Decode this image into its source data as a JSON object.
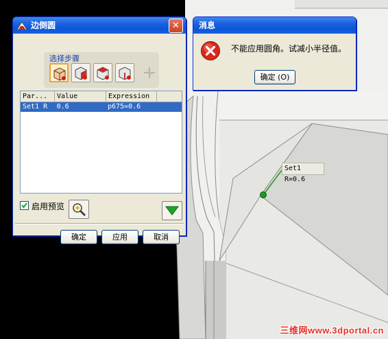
{
  "fillet_dialog": {
    "title": "边倒圆",
    "close_glyph": "✕",
    "steps": {
      "label": "选择步骤",
      "buttons": [
        "edge-select-icon",
        "variable-radius-icon",
        "setback-icon",
        "stop-short-icon",
        "cliff-edge-icon"
      ]
    },
    "table": {
      "headers": [
        "Par...",
        "Value",
        "Expression"
      ],
      "rows": [
        {
          "param": "Set1 R",
          "value": "0.6",
          "expression": "p675=0.6"
        }
      ]
    },
    "preview": {
      "label": "启用预览",
      "checked": true
    },
    "buttons": {
      "ok": "确定",
      "apply": "应用",
      "cancel": "取消"
    }
  },
  "message_dialog": {
    "title": "消息",
    "text": "不能应用圆角。试减小半径值。",
    "ok_label": "确定 (O)"
  },
  "viewport": {
    "dimension_label": "Set1 R=0.6",
    "watermark": "三维网www.3dportal.cn",
    "colors": {
      "background": "#000000",
      "surface": "#e6e6e2",
      "shadow": "#c9c9c5",
      "handle": "#1f9a1f"
    }
  }
}
